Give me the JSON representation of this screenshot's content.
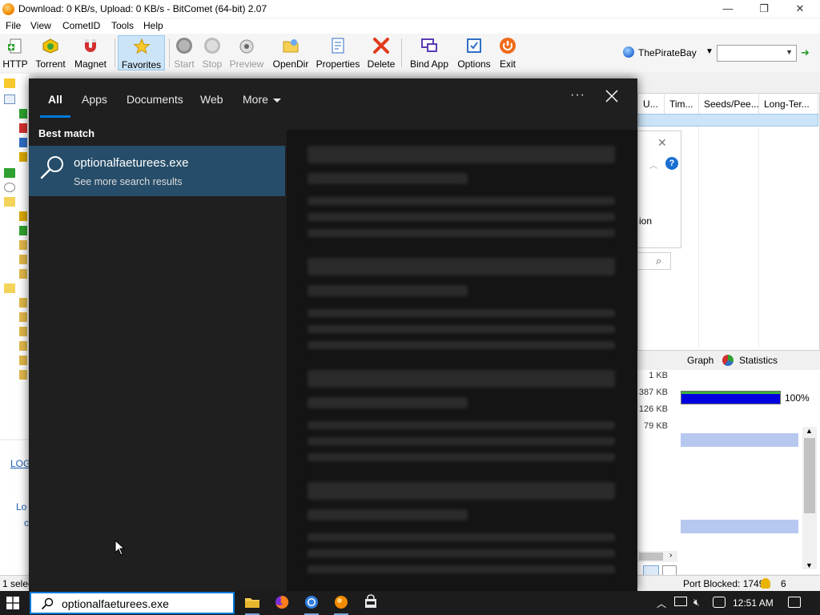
{
  "window": {
    "title": "Download: 0 KB/s, Upload: 0 KB/s - BitComet (64-bit) 2.07",
    "minimize": "—",
    "maximize": "❐",
    "close": "✕"
  },
  "menu": [
    "File",
    "View",
    "CometID",
    "Tools",
    "Help"
  ],
  "toolbar": {
    "http": "HTTP",
    "torrent": "Torrent",
    "magnet": "Magnet",
    "favorites": "Favorites",
    "start": "Start",
    "stop": "Stop",
    "preview": "Preview",
    "opendir": "OpenDir",
    "properties": "Properties",
    "delete": "Delete",
    "bind_app": "Bind App",
    "options": "Options",
    "exit": "Exit"
  },
  "site": {
    "name": "ThePirateBay"
  },
  "columns": [
    "U...",
    "Tim...",
    "Seeds/Pee...",
    "Long-Ter..."
  ],
  "details": {
    "tabs": [
      "Graph",
      "Statistics"
    ],
    "sizes": [
      "1 KB",
      "387 KB",
      "126 KB",
      "79 KB"
    ],
    "progress_percent": 100,
    "progress_label": "100%",
    "fragment_text": "ion"
  },
  "statusbar": {
    "selected": "1 selec",
    "port": "Port Blocked: 17495",
    "count": "6"
  },
  "left_panel": {
    "link1": "LOG",
    "link2": "Lo",
    "link3": "c"
  },
  "search": {
    "tabs": [
      "All",
      "Apps",
      "Documents",
      "Web",
      "More"
    ],
    "best_match_label": "Best match",
    "best_match_name": "optionalfaeturees.exe",
    "best_match_sub": "See more search results",
    "dots": "···",
    "query": "optionalfaeturees.exe"
  },
  "taskbar": {
    "clock": "12:51 AM"
  },
  "colors": {
    "accent": "#0078d7",
    "best_match_bg": "#264d69",
    "panel_bg": "#1f1f1f",
    "progress_fill": "#0000e0"
  }
}
